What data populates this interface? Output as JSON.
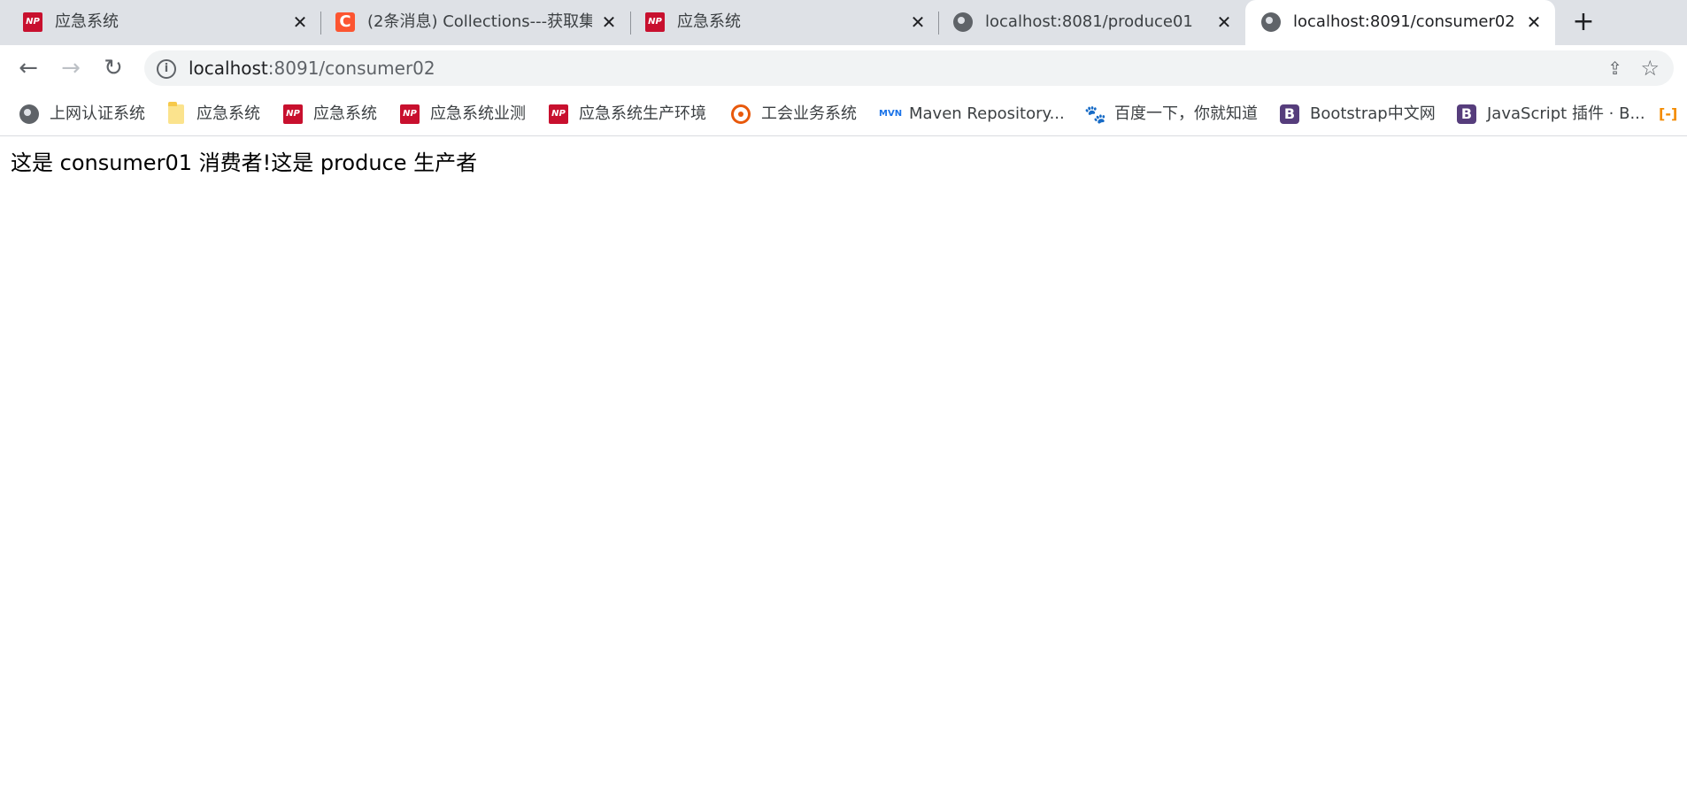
{
  "tabs": [
    {
      "title": "应急系统",
      "icon": "np-icon",
      "active": false
    },
    {
      "title": "(2条消息) Collections---获取集",
      "icon": "csdn-icon",
      "active": false
    },
    {
      "title": "应急系统",
      "icon": "np-icon",
      "active": false
    },
    {
      "title": "localhost:8081/produce01",
      "icon": "globe-icon",
      "active": false
    },
    {
      "title": "localhost:8091/consumer02",
      "icon": "globe-icon",
      "active": true
    }
  ],
  "new_tab_label": "+",
  "toolbar": {
    "back_glyph": "←",
    "forward_glyph": "→",
    "reload_glyph": "↻",
    "url_host": "localhost",
    "url_rest": ":8091/consumer02",
    "info_glyph": "i",
    "share_glyph": "⇪",
    "star_glyph": "☆"
  },
  "bookmarks": [
    {
      "label": "上网认证系统",
      "icon": "globe-icon"
    },
    {
      "label": "应急系统",
      "icon": "folder-icon"
    },
    {
      "label": "应急系统",
      "icon": "np-icon"
    },
    {
      "label": "应急系统业测",
      "icon": "np-icon"
    },
    {
      "label": "应急系统生产环境",
      "icon": "np-icon"
    },
    {
      "label": "工会业务系统",
      "icon": "union-icon"
    },
    {
      "label": "Maven Repository...",
      "icon": "mvn-icon"
    },
    {
      "label": "百度一下，你就知道",
      "icon": "baidu-icon"
    },
    {
      "label": "Bootstrap中文网",
      "icon": "bootstrap-icon"
    },
    {
      "label": "JavaScript 插件 · B...",
      "icon": "bootstrap-icon"
    }
  ],
  "icon_text": {
    "np": "NP",
    "csdn": "C",
    "mvn": "MVN",
    "baidu": "🐾",
    "bootstrap": "B",
    "overflow": "[-]"
  },
  "page": {
    "message": "这是 consumer01 消费者!这是 produce 生产者"
  },
  "colors": {
    "tabstrip_bg": "#dee1e6",
    "omnibox_bg": "#f1f3f4",
    "np_red": "#c8102e",
    "csdn_orange": "#fc5531",
    "bootstrap_purple": "#563d7c"
  }
}
